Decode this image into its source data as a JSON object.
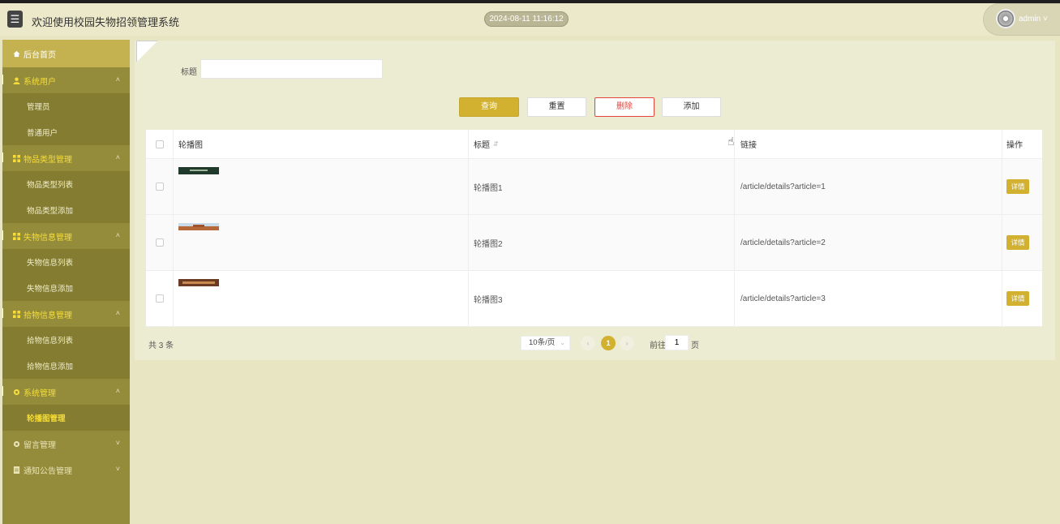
{
  "header": {
    "menu_icon": "hamburger-icon",
    "title": "欢迎使用校园失物招领管理系统",
    "datetime": "2024-08-11 11:16:12",
    "user": "admin ˅"
  },
  "sidebar": {
    "home": "后台首页",
    "groups": [
      {
        "label": "系统用户",
        "caret": "˄",
        "items": [
          "管理员",
          "普通用户"
        ]
      },
      {
        "label": "物品类型管理",
        "caret": "˄",
        "items": [
          "物品类型列表",
          "物品类型添加"
        ]
      },
      {
        "label": "失物信息管理",
        "caret": "˄",
        "items": [
          "失物信息列表",
          "失物信息添加"
        ]
      },
      {
        "label": "拾物信息管理",
        "caret": "˄",
        "items": [
          "拾物信息列表",
          "拾物信息添加"
        ]
      },
      {
        "label": "系统管理",
        "caret": "˄",
        "items": [
          "轮播图管理"
        ]
      },
      {
        "label": "留言管理",
        "caret": "˅",
        "items": []
      },
      {
        "label": "通知公告管理",
        "caret": "˅",
        "items": []
      }
    ],
    "active_item": "轮播图管理"
  },
  "search": {
    "title_label": "标题",
    "title_value": "",
    "query_btn": "查询",
    "reset_btn": "重置",
    "delete_btn": "删除",
    "add_btn": "添加"
  },
  "table": {
    "headers": [
      "轮播图",
      "标题",
      "链接",
      "操作"
    ],
    "rows": [
      {
        "title": "轮播图1",
        "link": "/article/details?article=1",
        "action": "详情"
      },
      {
        "title": "轮播图2",
        "link": "/article/details?article=2",
        "action": "详情"
      },
      {
        "title": "轮播图3",
        "link": "/article/details?article=3",
        "action": "详情"
      }
    ]
  },
  "pagination": {
    "total": "共 3 条",
    "page_size": "10条/页",
    "current_page": "1",
    "goto_label": "前往",
    "goto_value": "1",
    "page_unit": "页"
  },
  "colors": {
    "accent": "#d1b12f",
    "sidebar": "#948c3a",
    "danger": "#e2433a"
  }
}
